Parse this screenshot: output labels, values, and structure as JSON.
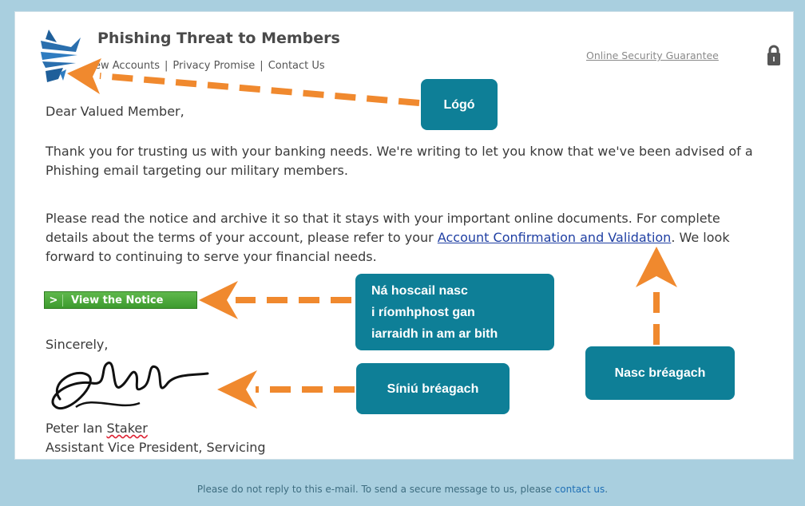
{
  "header": {
    "title": "Phishing Threat to Members",
    "nav_partial_label": "ew Accounts",
    "nav_links": [
      "Privacy Promise",
      "Contact Us"
    ],
    "separator": "|",
    "guarantee_link": "Online Security Guarantee"
  },
  "letter": {
    "greeting": "Dear Valued Member,",
    "paragraph1": "Thank you for trusting us with your banking needs. We're writing to let you know that we've been advised of a Phishing email targeting our military members.",
    "paragraph2_before": "Please read the notice and archive it so that it stays with your important online documents. For complete details about the terms of your account, please refer to your ",
    "paragraph2_link": "Account Confirmation and Validation",
    "paragraph2_after": ". We look forward to continuing to serve your financial needs.",
    "button_chevron": ">",
    "button_label": "View the Notice",
    "closing": "Sincerely,",
    "signer_first": "Peter Ian ",
    "signer_last": "Staker",
    "signer_title": "Assistant Vice President, Servicing"
  },
  "footer": {
    "text_before": "Please do not reply to this e-mail. To send a secure message to us, please ",
    "link": "contact us",
    "text_after": "."
  },
  "callouts": {
    "logo": "Lógó",
    "no_open_line1": "Ná hoscail nasc",
    "no_open_line2": "i ríomhphost gan",
    "no_open_line3": "iarraidh in am ar bith",
    "fake_signature": "Síniú bréagach",
    "fake_link": "Nasc bréagach"
  },
  "colors": {
    "background": "#a9cfdf",
    "callout": "#0e7f97",
    "arrow": "#f0892e",
    "button": "#4aa83b"
  },
  "icons": [
    "eagle-logo-icon",
    "padlock-icon",
    "signature-icon"
  ]
}
